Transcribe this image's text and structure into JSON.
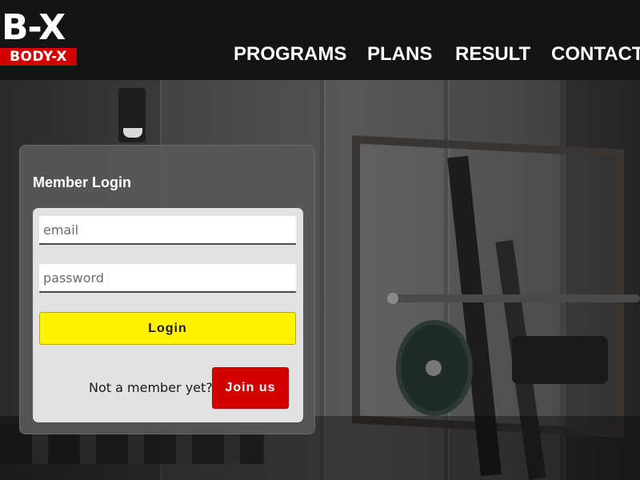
{
  "header": {
    "logo_main": "B-X",
    "logo_tag": "BODY-X",
    "nav": {
      "programs": "PROGRAMS",
      "plans": "PLANS",
      "result": "RESULT",
      "contact": "CONTACT"
    }
  },
  "login": {
    "title": "Member Login",
    "email_placeholder": "email",
    "password_placeholder": "password",
    "login_button": "Login",
    "not_member_text": "Not a member yet?",
    "join_button": "Join us"
  },
  "colors": {
    "header_bg": "#141414",
    "brand_red": "#d40000",
    "login_yellow": "#fff200"
  }
}
